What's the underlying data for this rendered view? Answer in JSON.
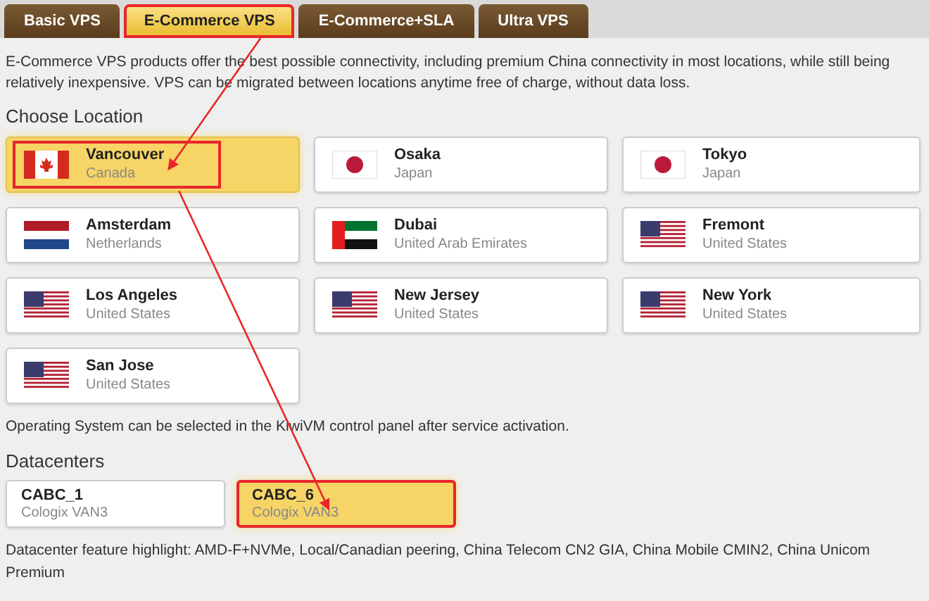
{
  "tabs": [
    {
      "label": "Basic VPS",
      "selected": false,
      "highlighted": false
    },
    {
      "label": "E-Commerce VPS",
      "selected": true,
      "highlighted": true
    },
    {
      "label": "E-Commerce+SLA",
      "selected": false,
      "highlighted": false
    },
    {
      "label": "Ultra VPS",
      "selected": false,
      "highlighted": false
    }
  ],
  "intro": "E-Commerce VPS products offer the best possible connectivity, including premium China connectivity in most locations, while still being relatively inexpensive. VPS can be migrated between locations anytime free of charge, without data loss.",
  "location_heading": "Choose Location",
  "locations": [
    {
      "name": "Vancouver",
      "country": "Canada",
      "kind": "ca",
      "selected": true,
      "highlighted": true
    },
    {
      "name": "Osaka",
      "country": "Japan",
      "kind": "jp",
      "selected": false,
      "highlighted": false
    },
    {
      "name": "Tokyo",
      "country": "Japan",
      "kind": "jp",
      "selected": false,
      "highlighted": false
    },
    {
      "name": "Amsterdam",
      "country": "Netherlands",
      "kind": "nl",
      "selected": false,
      "highlighted": false
    },
    {
      "name": "Dubai",
      "country": "United Arab Emirates",
      "kind": "ae",
      "selected": false,
      "highlighted": false
    },
    {
      "name": "Fremont",
      "country": "United States",
      "kind": "us",
      "selected": false,
      "highlighted": false
    },
    {
      "name": "Los Angeles",
      "country": "United States",
      "kind": "us",
      "selected": false,
      "highlighted": false
    },
    {
      "name": "New Jersey",
      "country": "United States",
      "kind": "us",
      "selected": false,
      "highlighted": false
    },
    {
      "name": "New York",
      "country": "United States",
      "kind": "us",
      "selected": false,
      "highlighted": false
    },
    {
      "name": "San Jose",
      "country": "United States",
      "kind": "us",
      "selected": false,
      "highlighted": false
    }
  ],
  "os_note": "Operating System can be selected in the KiwiVM control panel after service activation.",
  "datacenter_heading": "Datacenters",
  "datacenters": [
    {
      "name": "CABC_1",
      "site": "Cologix VAN3",
      "selected": false,
      "highlighted": false
    },
    {
      "name": "CABC_6",
      "site": "Cologix VAN3",
      "selected": true,
      "highlighted": true
    }
  ],
  "feature_note": "Datacenter feature highlight: AMD-F+NVMe, Local/Canadian peering, China Telecom CN2 GIA, China Mobile CMIN2, China Unicom Premium"
}
